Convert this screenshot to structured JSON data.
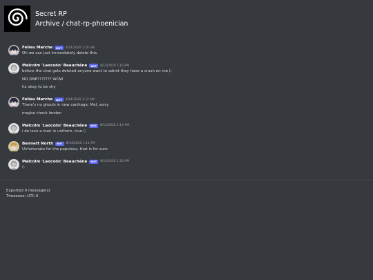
{
  "header": {
    "guild_name": "Secret RP",
    "channel_path": "Archive / chat-rp-phoenician",
    "icon": "spiral-logo-icon"
  },
  "messages": [
    {
      "author": "Felieu Marche",
      "bot_tag": "BOT",
      "timestamp": "8/14/2020 1:10 AM",
      "avatar": "dark-haired-character-avatar",
      "lines": [
        "Oh we can just immediately delete this."
      ]
    },
    {
      "author": "Malcolm 'Laocoön' Beauchêne",
      "bot_tag": "BOT",
      "timestamp": "8/14/2020 1:10 AM",
      "avatar": "grey-character-avatar",
      "lines": [
        "before the chat gets deleted anyone want to admit they have a crush on me (:",
        "NO ONE??????? WOW",
        "its okay to be shy"
      ]
    },
    {
      "author": "Felieu Marche",
      "bot_tag": "BOT",
      "timestamp": "8/14/2020 1:12 AM",
      "avatar": "dark-haired-character-avatar",
      "lines": [
        "There's no ghouls in new carthage, Mal, sorry",
        "maybe check london"
      ]
    },
    {
      "author": "Malcolm 'Laocoön' Beauchêne",
      "bot_tag": "BOT",
      "timestamp": "8/14/2020 1:13 AM",
      "avatar": "grey-character-avatar",
      "lines": [
        "i do love a man in uniform, true (:"
      ]
    },
    {
      "author": "Bennett North",
      "bot_tag": "BOT",
      "timestamp": "8/14/2020 1:14 AM",
      "avatar": "blond-character-avatar",
      "lines": [
        "Unfortunate for the populous, that is for sure"
      ]
    },
    {
      "author": "Malcolm 'Laocoön' Beauchêne",
      "bot_tag": "BOT",
      "timestamp": "8/14/2020 1:18 AM",
      "avatar": "grey-character-avatar",
      "lines": [
        "(:"
      ]
    }
  ],
  "footer": {
    "exported": "Exported 9 message(s)",
    "timezone": "Timezone: UTC-6"
  },
  "colors": {
    "background": "#36393e",
    "bot_tag": "#5865f2",
    "divider": "#42454a"
  }
}
